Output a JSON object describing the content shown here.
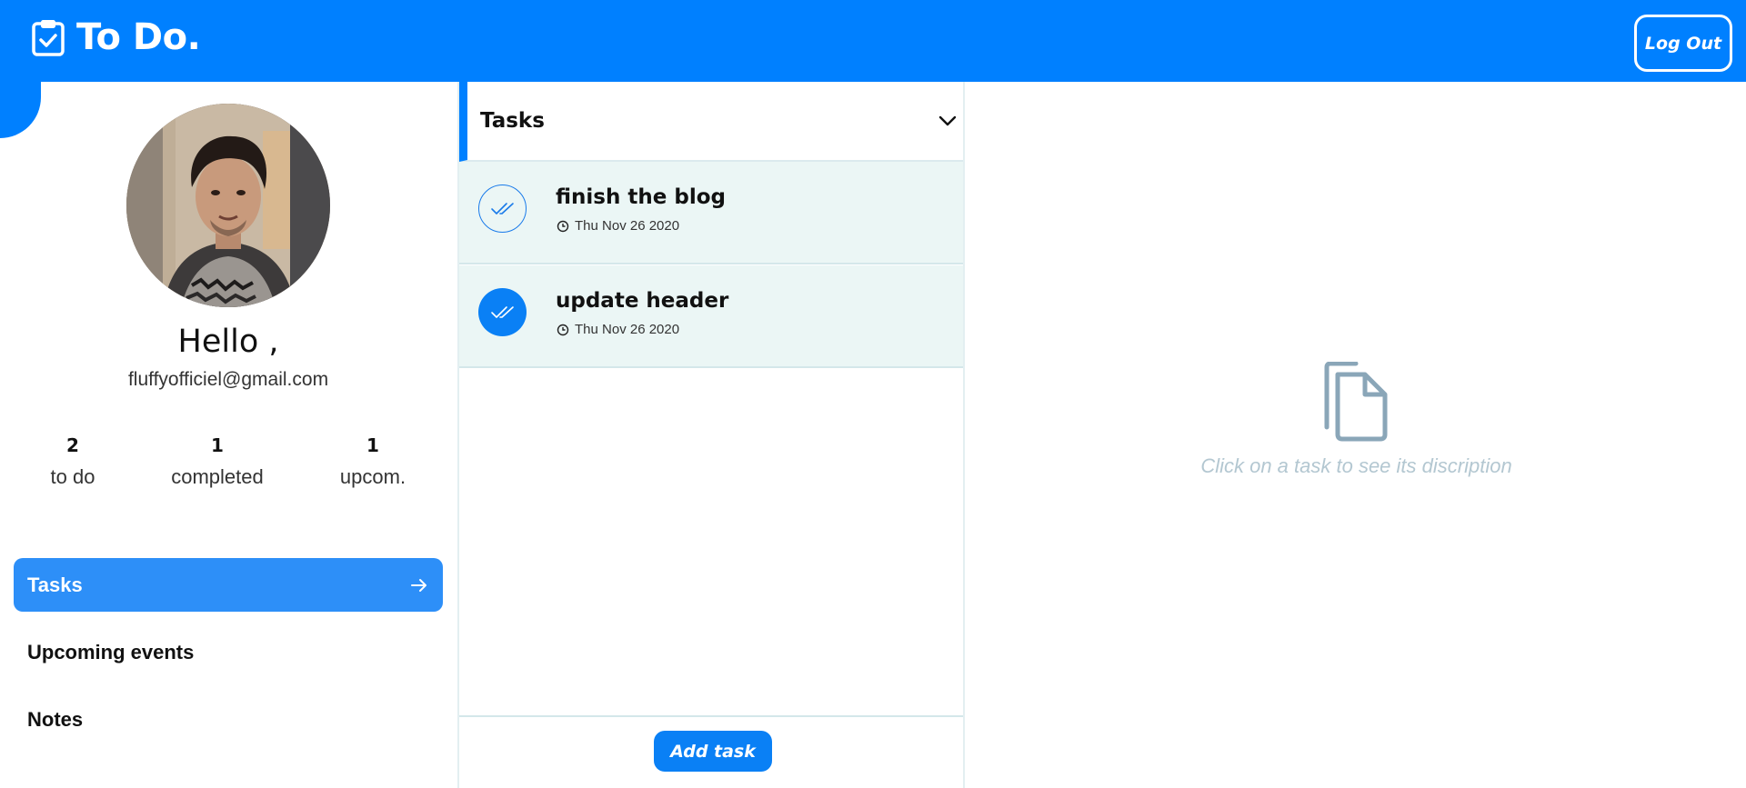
{
  "app": {
    "title": "To Do.",
    "logout_label": "Log Out",
    "colors": {
      "brand": "#0080ff",
      "active_nav": "#2d8ff8",
      "task_bg": "#ebf6f5",
      "hint": "#b3c7d1"
    }
  },
  "profile": {
    "greeting": "Hello ,",
    "email": "fluffyofficiel@gmail.com",
    "stats": [
      {
        "value": "2",
        "label": "to do"
      },
      {
        "value": "1",
        "label": "completed"
      },
      {
        "value": "1",
        "label": "upcom."
      }
    ]
  },
  "nav": {
    "items": [
      {
        "label": "Tasks",
        "active": true,
        "icon": "arrow-right-icon"
      },
      {
        "label": "Upcoming events",
        "active": false
      },
      {
        "label": "Notes",
        "active": false
      }
    ]
  },
  "tasks": {
    "title": "Tasks",
    "items": [
      {
        "title": "finish the blog",
        "date": "Thu Nov 26 2020",
        "completed": false
      },
      {
        "title": "update header",
        "date": "Thu Nov 26 2020",
        "completed": true
      }
    ],
    "add_label": "Add task"
  },
  "detail": {
    "hint": "Click on a task to see its discription",
    "icon": "document-copy-icon"
  }
}
